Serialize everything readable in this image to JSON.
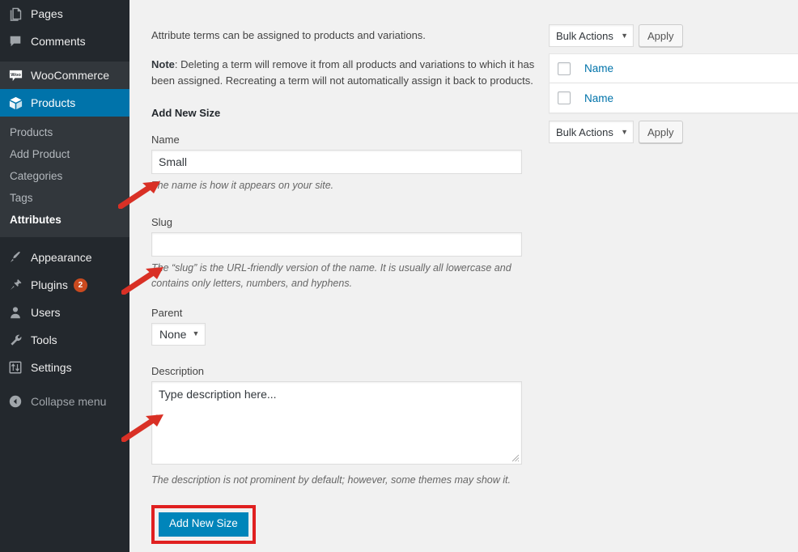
{
  "sidebar": {
    "top_items": [
      {
        "label": "Pages",
        "icon": "pages-icon"
      },
      {
        "label": "Comments",
        "icon": "comments-icon"
      }
    ],
    "woocommerce": {
      "label": "WooCommerce",
      "icon": "woocommerce-icon"
    },
    "products": {
      "label": "Products",
      "icon": "products-box-icon"
    },
    "submenu": [
      {
        "label": "Products",
        "active": false
      },
      {
        "label": "Add Product",
        "active": false
      },
      {
        "label": "Categories",
        "active": false
      },
      {
        "label": "Tags",
        "active": false
      },
      {
        "label": "Attributes",
        "active": true
      }
    ],
    "bottom_items": [
      {
        "label": "Appearance",
        "icon": "paintbrush-icon",
        "badge": ""
      },
      {
        "label": "Plugins",
        "icon": "plug-icon",
        "badge": "2"
      },
      {
        "label": "Users",
        "icon": "user-icon",
        "badge": ""
      },
      {
        "label": "Tools",
        "icon": "wrench-icon",
        "badge": ""
      },
      {
        "label": "Settings",
        "icon": "sliders-icon",
        "badge": ""
      }
    ],
    "collapse": {
      "label": "Collapse menu",
      "icon": "collapse-arrow-icon"
    },
    "colors": {
      "background": "#23282d",
      "submenu_background": "#32373c",
      "current_item": "#0073aa",
      "badge": "#ca4a1f"
    }
  },
  "main": {
    "intro_paragraph": "Attribute terms can be assigned to products and variations.",
    "note_label": "Note",
    "note_text": ": Deleting a term will remove it from all products and variations to which it has been assigned. Recreating a term will not automatically assign it back to products.",
    "section_title": "Add New Size",
    "fields": {
      "name": {
        "label": "Name",
        "value": "Small",
        "placeholder": "",
        "help": "The name is how it appears on your site."
      },
      "slug": {
        "label": "Slug",
        "value": "",
        "placeholder": "",
        "help": "The “slug” is the URL-friendly version of the name. It is usually all lowercase and contains only letters, numbers, and hyphens."
      },
      "parent": {
        "label": "Parent",
        "selected": "None",
        "options": [
          "None"
        ]
      },
      "description": {
        "label": "Description",
        "value": "Type description here...",
        "placeholder": "",
        "help": "The description is not prominent by default; however, some themes may show it."
      }
    },
    "submit_button": "Add New Size",
    "submit_highlight_color": "#e02020",
    "primary_button_color": "#0085ba"
  },
  "terms_panel": {
    "bulk_actions_top": {
      "select_label": "Bulk Actions",
      "apply_label": "Apply"
    },
    "bulk_actions_bottom": {
      "select_label": "Bulk Actions",
      "apply_label": "Apply"
    },
    "columns": [
      "Name"
    ],
    "rows": [
      {
        "name": "Name"
      },
      {
        "name": "Name"
      }
    ],
    "link_color": "#0073aa"
  },
  "annotations": {
    "arrow_color": "#d93025",
    "count": 3
  }
}
